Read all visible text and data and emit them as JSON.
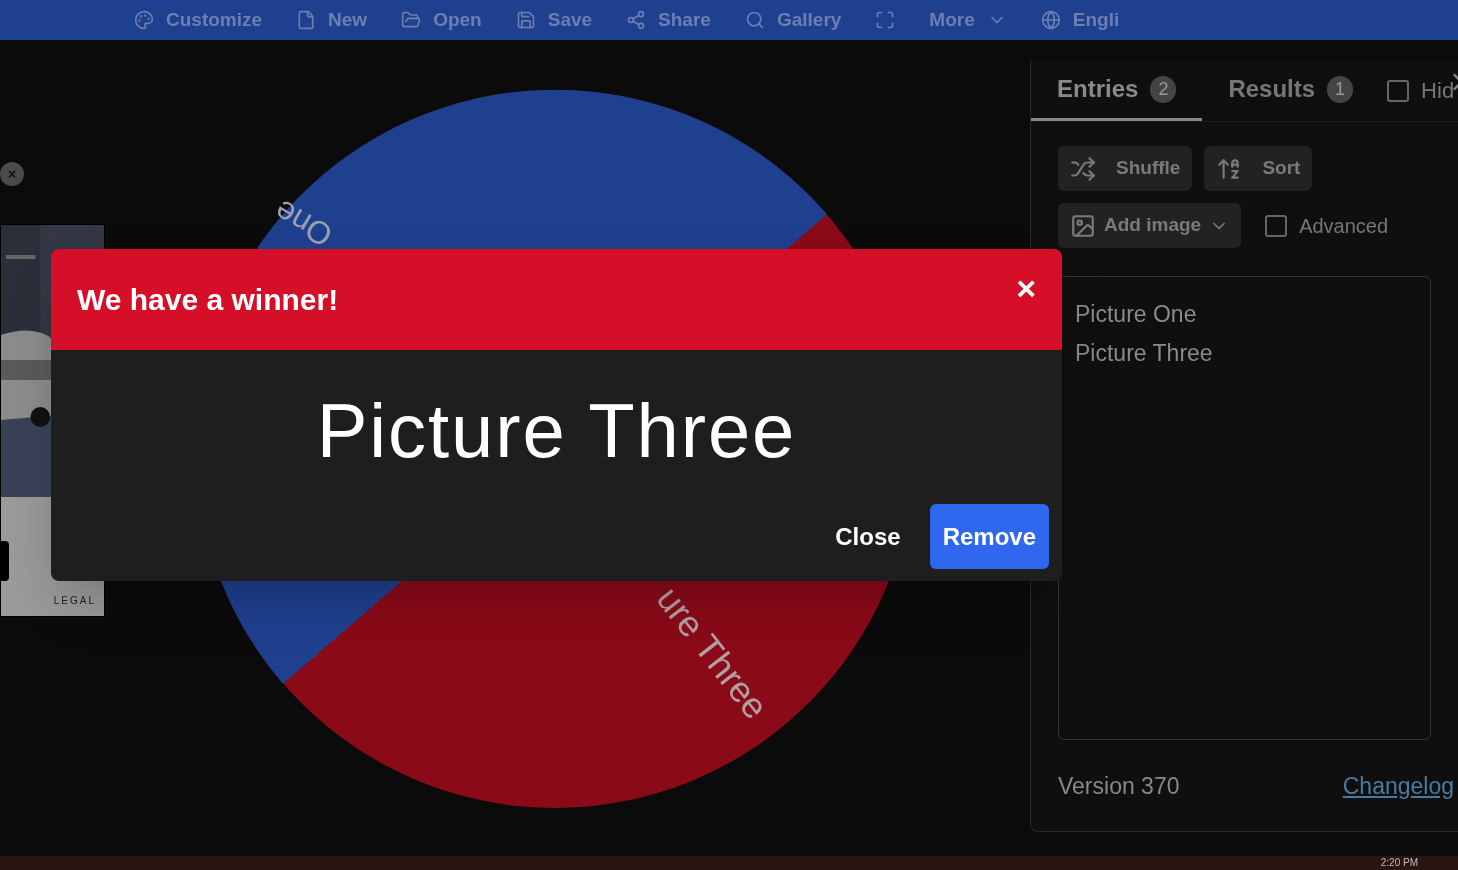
{
  "nav": [
    {
      "label": "Customize",
      "kind": "palette"
    },
    {
      "label": "New",
      "kind": "file"
    },
    {
      "label": "Open",
      "kind": "folder"
    },
    {
      "label": "Save",
      "kind": "save"
    },
    {
      "label": "Share",
      "kind": "share"
    },
    {
      "label": "Gallery",
      "kind": "search"
    },
    {
      "kind": "fullscreen"
    },
    {
      "label": "More",
      "kind": "more"
    },
    {
      "label": "Engli",
      "kind": "globe"
    }
  ],
  "ad": {
    "close": "×",
    "footer": "LEGAL"
  },
  "wheel": {
    "segments": [
      {
        "label": "One",
        "color": "#1f3f8f"
      },
      {
        "label": "ure Three",
        "color": "#8a0a18"
      }
    ]
  },
  "tabs": [
    {
      "label": "Entries",
      "count": "2",
      "selected": true
    },
    {
      "label": "Results",
      "count": "1",
      "selected": false
    }
  ],
  "hide": {
    "label": "Hid",
    "checked": false
  },
  "buttons": [
    {
      "label": "Shuffle",
      "kind": "shuffle"
    },
    {
      "label": "Sort",
      "kind": "sort"
    }
  ],
  "add_image": "Add image",
  "advanced": {
    "label": "Advanced",
    "checked": false
  },
  "entries": [
    "Picture One",
    "Picture Three"
  ],
  "version": "Version 370",
  "changelog": "Changelog",
  "dialog": {
    "title": "We have a winner!",
    "close": "×",
    "winner": "Picture Three",
    "buttons": [
      {
        "label": "Close",
        "kind": "text"
      },
      {
        "label": "Remove",
        "kind": "primary"
      }
    ]
  },
  "taskbar": {
    "time": "2:20 PM"
  }
}
